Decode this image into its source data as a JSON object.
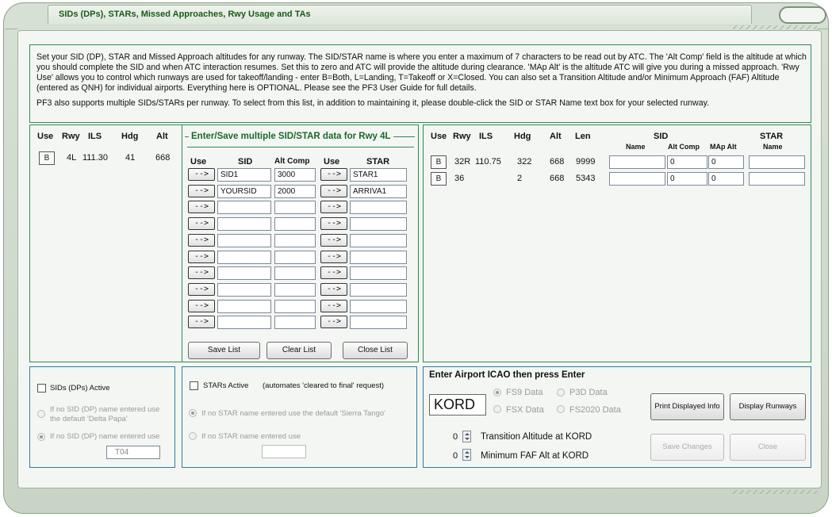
{
  "window": {
    "title": "SIDs (DPs), STARs, Missed Approaches, Rwy Usage and TAs"
  },
  "intro": {
    "paragraph1": "Set your SID (DP), STAR and Missed Approach altitudes for any runway. The SID/STAR name is where you enter a maximum of 7 characters to be read out by ATC. The 'Alt Comp' field is the altitude at which you should complete the SID and when ATC interaction resumes. Set this to zero and ATC will provide the altitude during clearance. 'MAp Alt' is the altitude ATC will give you during a missed approach. 'Rwy Use' allows you to control which runways are used for takeoff/landing - enter B=Both, L=Landing, T=Takeoff or X=Closed.  You can also set a Transition Altitude and/or Minimum Approach (FAF) Altitude (entered as QNH) for individual airports. Everything here is OPTIONAL. Please see the PF3 User Guide for full details.",
    "paragraph2": "PF3 also supports multiple SIDs/STARs per runway. To select from this list, in addition to maintaining it, please double-click the SID or STAR Name text box for your selected runway."
  },
  "left_runways": {
    "headers": {
      "use": "Use",
      "rwy": "Rwy",
      "ils": "ILS",
      "hdg": "Hdg",
      "alt": "Alt"
    },
    "rows": [
      {
        "use": "B",
        "rwy": "4L",
        "ils": "111.30",
        "hdg": "41",
        "alt": "668"
      }
    ]
  },
  "multi": {
    "title": "Enter/Save multiple SID/STAR data for Rwy 4L",
    "headers": {
      "use1": "Use",
      "sid": "SID",
      "alt_comp": "Alt Comp",
      "use2": "Use",
      "star": "STAR"
    },
    "arrow": "-->",
    "rows": [
      {
        "sid": "SID1",
        "alt_comp": "3000",
        "star": "STAR1"
      },
      {
        "sid": "YOURSID",
        "alt_comp": "2000",
        "star": "ARRIVA1"
      },
      {
        "sid": "",
        "alt_comp": "",
        "star": ""
      },
      {
        "sid": "",
        "alt_comp": "",
        "star": ""
      },
      {
        "sid": "",
        "alt_comp": "",
        "star": ""
      },
      {
        "sid": "",
        "alt_comp": "",
        "star": ""
      },
      {
        "sid": "",
        "alt_comp": "",
        "star": ""
      },
      {
        "sid": "",
        "alt_comp": "",
        "star": ""
      },
      {
        "sid": "",
        "alt_comp": "",
        "star": ""
      },
      {
        "sid": "",
        "alt_comp": "",
        "star": ""
      }
    ],
    "buttons": {
      "save": "Save List",
      "clear": "Clear List",
      "close": "Close List"
    }
  },
  "right_runways": {
    "headers": {
      "use": "Use",
      "rwy": "Rwy",
      "ils": "ILS",
      "hdg": "Hdg",
      "alt": "Alt",
      "len": "Len",
      "sid": "SID",
      "star": "STAR",
      "sid_name": "Name",
      "alt_comp": "Alt Comp",
      "map_alt": "MAp Alt",
      "star_name": "Name"
    },
    "rows": [
      {
        "use": "B",
        "rwy": "32R",
        "ils": "110.75",
        "hdg": "322",
        "alt": "668",
        "len": "9999",
        "sid_name": "",
        "alt_comp": "0",
        "map_alt": "0",
        "star_name": ""
      },
      {
        "use": "B",
        "rwy": "36",
        "ils": "",
        "hdg": "2",
        "alt": "668",
        "len": "5343",
        "sid_name": "",
        "alt_comp": "0",
        "map_alt": "0",
        "star_name": ""
      }
    ]
  },
  "sids_panel": {
    "active_label": "SIDs (DPs) Active",
    "opt1": "If no SID (DP) name entered use the default 'Delta Papa'",
    "opt2": "If no SID (DP) name entered use",
    "value": "T04"
  },
  "stars_panel": {
    "active_label": "STARs Active",
    "note": "(automates 'cleared to final' request)",
    "opt1": "If no STAR name entered use the default 'Sierra Tango'",
    "opt2": "If no STAR name entered use",
    "value": ""
  },
  "airport_panel": {
    "title": "Enter Airport ICAO then press Enter",
    "icao": "KORD",
    "radios": {
      "fs9": "FS9 Data",
      "p3d": "P3D Data",
      "fsx": "FSX Data",
      "fs2020": "FS2020 Data"
    },
    "transition_value": "0",
    "transition_label": "Transition Altitude at KORD",
    "faf_value": "0",
    "faf_label": "Minimum FAF Alt at KORD",
    "buttons": {
      "print": "Print Displayed Info",
      "display": "Display Runways",
      "save": "Save Changes",
      "close": "Close"
    }
  }
}
